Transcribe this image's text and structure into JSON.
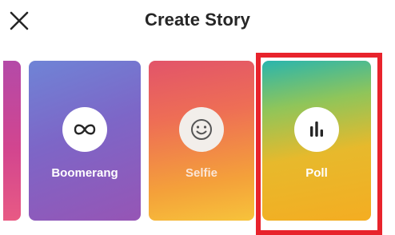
{
  "header": {
    "title": "Create Story"
  },
  "cards": {
    "boomerang": {
      "label": "Boomerang",
      "icon": "infinity-icon"
    },
    "selfie": {
      "label": "Selfie",
      "icon": "smiley-face-icon"
    },
    "poll": {
      "label": "Poll",
      "icon": "bar-chart-icon"
    }
  },
  "colors": {
    "highlight": "#e8232c",
    "boomerang": "#7d66c7",
    "selfie": "#ee6e55",
    "poll": "#f4ad22"
  }
}
